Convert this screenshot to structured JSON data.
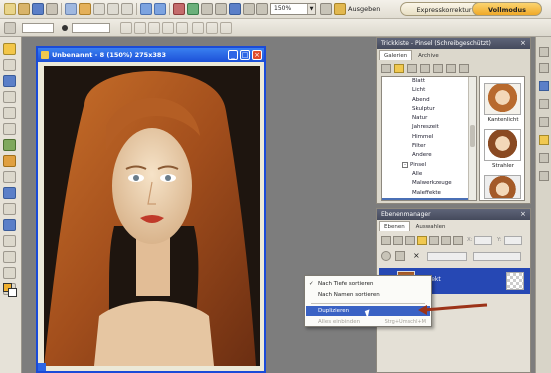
{
  "toolbar": {
    "zoom_value": "150%",
    "print_label": "Ausgeben",
    "tab_quick": "Expresskorrektur",
    "tab_full": "Vollmodus"
  },
  "document": {
    "title": "Unbenannt - 8 (150%) 275x383"
  },
  "effects_panel": {
    "title": "Trickkiste - Pinsel (Schreibgeschützt)",
    "tabs": [
      "Galerien",
      "Archive"
    ],
    "list": [
      "Blatt",
      "Licht",
      "Abend",
      "Skulptur",
      "Natur",
      "Jahreszeit",
      "Himmel",
      "Filter",
      "Andere",
      "Pinsel",
      "Alle",
      "Malwerkzeuge",
      "Maleffekte"
    ],
    "thumb_labels": [
      "Kantenlicht",
      "Strahler"
    ]
  },
  "layers_panel": {
    "title": "Ebenenmanager",
    "tabs": [
      "Ebenen",
      "Auswahlen"
    ],
    "field_x": "X:",
    "field_y": "Y:",
    "layer_name": "Objekt"
  },
  "context_menu": {
    "items": [
      "Nach Tiefe sortieren",
      "Nach Namen sortieren",
      "Duplizieren",
      "Alles einbinden"
    ],
    "shortcut": "Strg+Umschl+M"
  },
  "colors": {
    "title_blue": "#1c50d8",
    "panel_title": "#454a5c",
    "menu_highlight": "#3a62c4",
    "mode_tab": "#f5c242"
  }
}
